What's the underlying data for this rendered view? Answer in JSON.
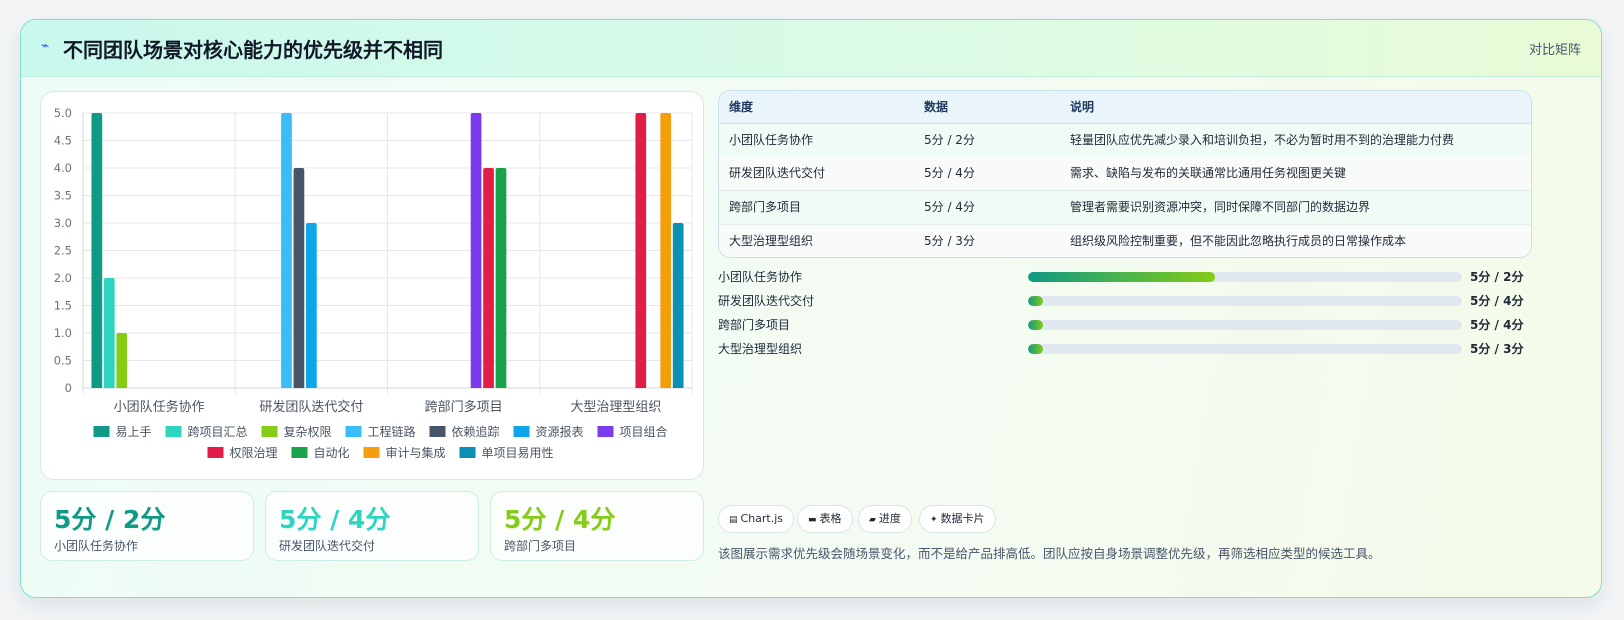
{
  "header": {
    "icon": "lightning-icon",
    "icon_glyph": "⌁",
    "title": "不同团队场景对核心能力的优先级并不相同",
    "tag": "对比矩阵"
  },
  "chart_data": {
    "type": "bar",
    "title": "",
    "xlabel": "",
    "ylabel": "",
    "ylim": [
      0,
      5
    ],
    "ytick_step": 0.5,
    "grid": true,
    "legend_position": "bottom",
    "categories": [
      "小团队任务协作",
      "研发团队迭代交付",
      "跨部门多项目",
      "大型治理型组织"
    ],
    "series": [
      {
        "name": "易上手",
        "color": "#0f9a85",
        "values": [
          5,
          0,
          0,
          0
        ]
      },
      {
        "name": "跨项目汇总",
        "color": "#2dd4bf",
        "values": [
          2,
          0,
          0,
          0
        ]
      },
      {
        "name": "复杂权限",
        "color": "#84cc16",
        "values": [
          1,
          0,
          0,
          0
        ]
      },
      {
        "name": "工程链路",
        "color": "#38bdf8",
        "values": [
          0,
          5,
          0,
          0
        ]
      },
      {
        "name": "依赖追踪",
        "color": "#475569",
        "values": [
          0,
          4,
          0,
          0
        ]
      },
      {
        "name": "资源报表",
        "color": "#0ea5e9",
        "values": [
          0,
          3,
          0,
          0
        ]
      },
      {
        "name": "项目组合",
        "color": "#7c3aed",
        "values": [
          0,
          0,
          5,
          0
        ]
      },
      {
        "name": "权限治理",
        "color": "#e11d48",
        "values": [
          0,
          0,
          4,
          5
        ]
      },
      {
        "name": "自动化",
        "color": "#16a34a",
        "values": [
          0,
          0,
          4,
          0
        ]
      },
      {
        "name": "审计与集成",
        "color": "#f59e0b",
        "values": [
          0,
          0,
          0,
          5
        ]
      },
      {
        "name": "单项目易用性",
        "color": "#0891b2",
        "values": [
          0,
          0,
          0,
          3
        ]
      }
    ]
  },
  "stats": [
    {
      "value": "5分 / 2分",
      "label": "小团队任务协作",
      "color": "#0f9a85"
    },
    {
      "value": "5分 / 4分",
      "label": "研发团队迭代交付",
      "color": "#2dd4bf"
    },
    {
      "value": "5分 / 4分",
      "label": "跨部门多项目",
      "color": "#84cc16"
    }
  ],
  "table": {
    "headers": [
      "维度",
      "数据",
      "说明"
    ],
    "rows": [
      [
        "小团队任务协作",
        "5分 / 2分",
        "轻量团队应优先减少录入和培训负担，不必为暂时用不到的治理能力付费"
      ],
      [
        "研发团队迭代交付",
        "5分 / 4分",
        "需求、缺陷与发布的关联通常比通用任务视图更关键"
      ],
      [
        "跨部门多项目",
        "5分 / 4分",
        "管理者需要识别资源冲突，同时保障不同部门的数据边界"
      ],
      [
        "大型治理型组织",
        "5分 / 3分",
        "组织级风险控制重要，但不能因此忽略执行成员的日常操作成本"
      ]
    ]
  },
  "progress": [
    {
      "label": "小团队任务协作",
      "value": "5分 / 2分",
      "fill_fraction": 0.43
    },
    {
      "label": "研发团队迭代交付",
      "value": "5分 / 4分",
      "fill_fraction": 0.035
    },
    {
      "label": "跨部门多项目",
      "value": "5分 / 4分",
      "fill_fraction": 0.035
    },
    {
      "label": "大型治理型组织",
      "value": "5分 / 3分",
      "fill_fraction": 0.035
    }
  ],
  "chips": [
    {
      "icon": "chart-icon",
      "glyph": "▤",
      "label": "Chart.js"
    },
    {
      "icon": "table-icon",
      "glyph": "▬",
      "label": "表格"
    },
    {
      "icon": "progress-icon",
      "glyph": "▰",
      "label": "进度"
    },
    {
      "icon": "sparkle-icon",
      "glyph": "✦",
      "label": "数据卡片"
    }
  ],
  "footnote": "该图展示需求优先级会随场景变化，而不是给产品排高低。团队应按自身场景调整优先级，再筛选相应类型的候选工具。"
}
